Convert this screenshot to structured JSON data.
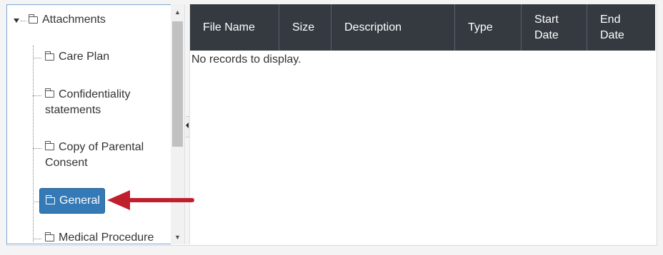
{
  "tree": {
    "root_label": "Attachments",
    "items": [
      {
        "label": "Care Plan"
      },
      {
        "label": "Confidentiality statements"
      },
      {
        "label": "Copy of Parental Consent"
      },
      {
        "label": "General"
      },
      {
        "label": "Medical Procedure"
      }
    ],
    "selected_index": 3
  },
  "grid": {
    "columns": [
      "File Name",
      "Size",
      "Description",
      "Type",
      "Start Date",
      "End Date"
    ],
    "empty_message": "No records to display."
  },
  "colors": {
    "header_bg": "#343a40",
    "selected_bg": "#337ab7",
    "annotation_arrow": "#c0202e"
  },
  "icons": {
    "folder": "folder-icon",
    "expand": "expanded-triangle-icon",
    "scroll_up": "scroll-up-arrow-icon",
    "scroll_down": "scroll-down-arrow-icon",
    "collapse_splitter": "collapse-left-arrow-icon",
    "annotation": "pointer-arrow-icon"
  }
}
